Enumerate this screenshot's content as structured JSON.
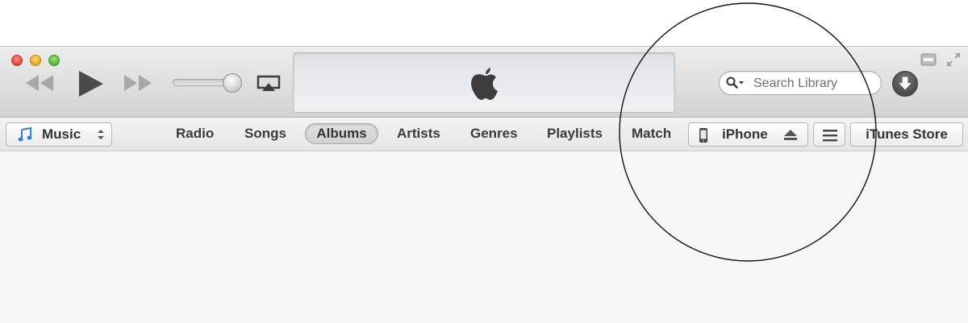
{
  "toolbar": {
    "search": {
      "placeholder": "Search Library"
    }
  },
  "navbar": {
    "media_selector": "Music",
    "tabs": [
      {
        "label": "Radio"
      },
      {
        "label": "Songs"
      },
      {
        "label": "Albums",
        "selected": true
      },
      {
        "label": "Artists"
      },
      {
        "label": "Genres"
      },
      {
        "label": "Playlists"
      },
      {
        "label": "Match"
      }
    ],
    "device": "iPhone",
    "store": "iTunes Store"
  },
  "icons": {
    "traffic_lights": [
      "close-icon",
      "minimize-icon",
      "zoom-icon"
    ],
    "transport": [
      "rewind-icon",
      "play-icon",
      "fast-forward-icon"
    ],
    "other": [
      "airplay-icon",
      "apple-logo",
      "search-icon",
      "downloads-icon",
      "miniplayer-icon",
      "fullscreen-icon",
      "music-note-icon",
      "iphone-icon",
      "eject-icon",
      "menu-icon"
    ]
  },
  "colors": {
    "toolbar_top": "#ededed",
    "toolbar_bottom": "#d3d3d3",
    "close": "#e0443a",
    "minimize": "#e3a71c",
    "zoom": "#58b33a",
    "music_note": "#2f7de1"
  }
}
